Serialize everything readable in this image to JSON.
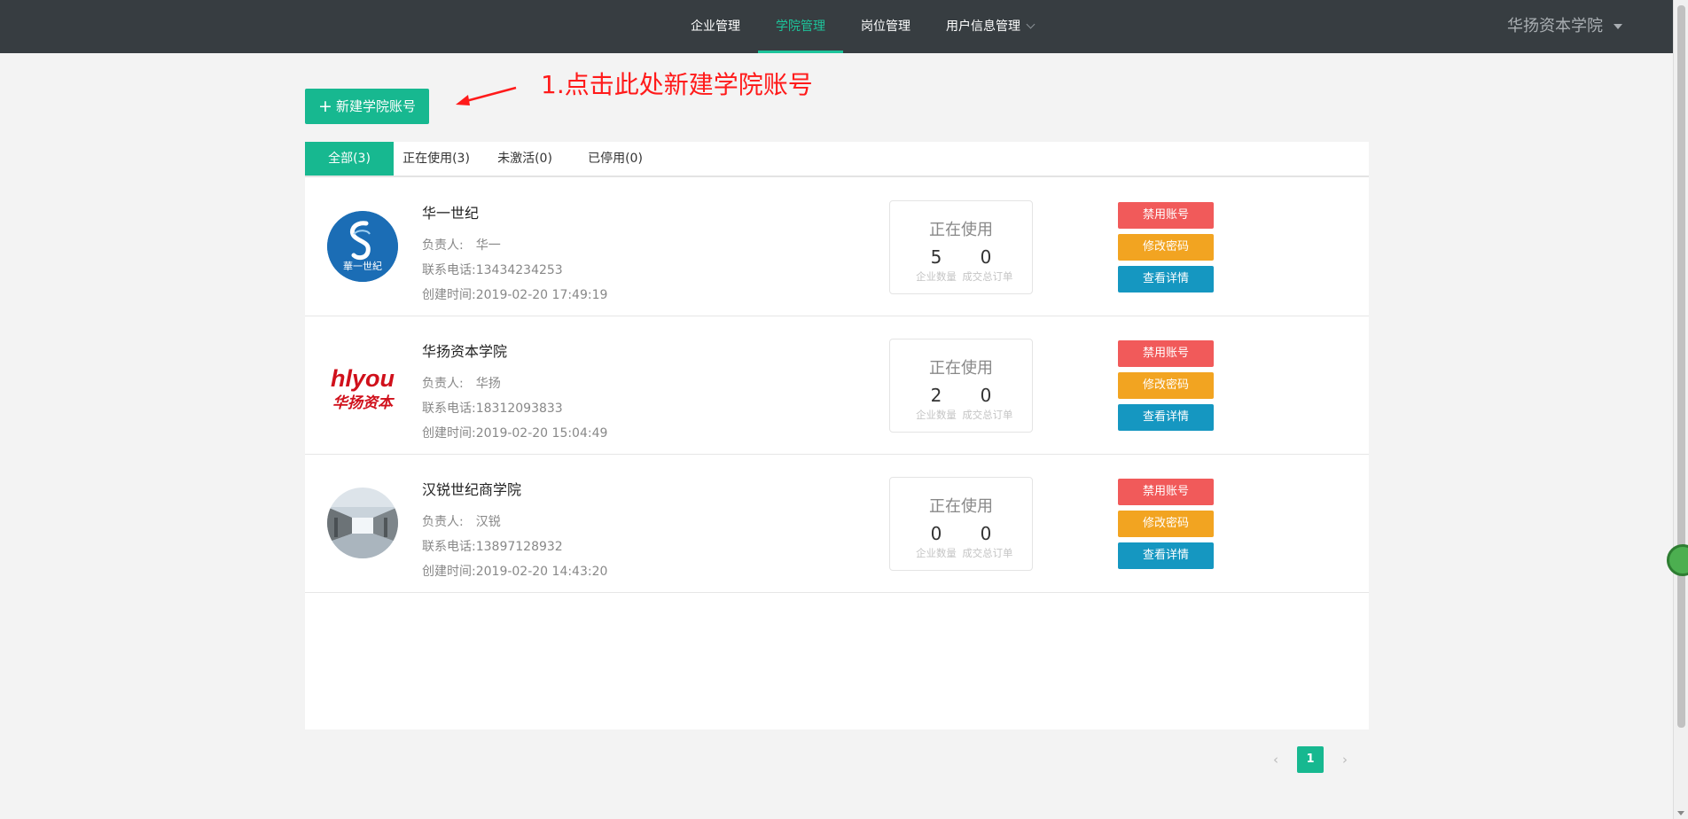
{
  "nav": {
    "items": [
      {
        "label": "企业管理"
      },
      {
        "label": "学院管理"
      },
      {
        "label": "岗位管理"
      },
      {
        "label": "用户信息管理"
      }
    ],
    "active_index": 1,
    "user": "华扬资本学院"
  },
  "toolbar": {
    "new_label": "新建学院账号",
    "annotation": "1.点击此处新建学院账号"
  },
  "tabs": [
    {
      "label": "全部(3)"
    },
    {
      "label": "正在使用(3)"
    },
    {
      "label": "未激活(0)"
    },
    {
      "label": "已停用(0)"
    }
  ],
  "labels": {
    "owner": "负责人:",
    "phone": "联系电话:",
    "created": "创建时间:",
    "company_count": "企业数量",
    "order_count": "成交总订单",
    "disable": "禁用账号",
    "change_password": "修改密码",
    "view_details": "查看详情"
  },
  "colleges": [
    {
      "name": "华一世纪",
      "owner": "华一",
      "phone": "13434234253",
      "created": "2019-02-20 17:49:19",
      "status": "正在使用",
      "companies": "5",
      "orders": "0",
      "logo": "huayi-logo",
      "logo_text": "華一世紀"
    },
    {
      "name": "华扬资本学院",
      "owner": "华扬",
      "phone": "18312093833",
      "created": "2019-02-20 15:04:49",
      "status": "正在使用",
      "companies": "2",
      "orders": "0",
      "logo": "hlyou-logo",
      "logo_text": "hlyou",
      "logo_subtext": "华扬资本"
    },
    {
      "name": "汉锐世纪商学院",
      "owner": "汉锐",
      "phone": "13897128932",
      "created": "2019-02-20 14:43:20",
      "status": "正在使用",
      "companies": "0",
      "orders": "0",
      "logo": "hallway-photo"
    }
  ],
  "pagination": {
    "current": "1",
    "prev": "‹",
    "next": "›"
  },
  "colors": {
    "accent": "#17b890",
    "danger": "#f15a5a",
    "warning": "#f2a421",
    "info": "#1597c1",
    "topbar": "#373d41",
    "annotation": "#ff1a1a"
  }
}
